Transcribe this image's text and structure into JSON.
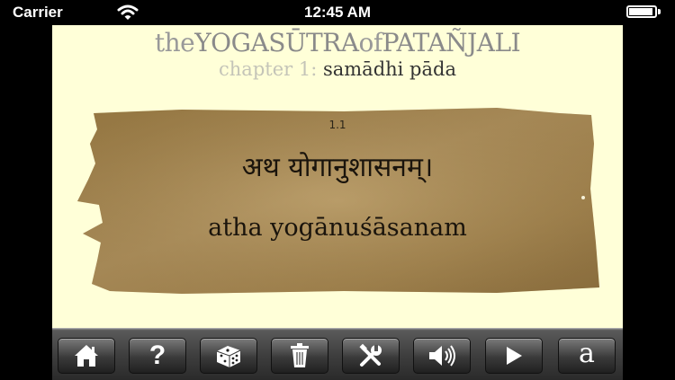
{
  "status_bar": {
    "carrier": "Carrier",
    "time": "12:45 AM"
  },
  "header": {
    "title_the": "the",
    "title_yoga": "YOGA",
    "title_sutra": "SŪTRA",
    "title_of": "of",
    "title_patanjali": "PATAÑJALI",
    "chapter_label": "chapter 1:",
    "chapter_name": "samādhi pāda"
  },
  "verse": {
    "number": "1.1",
    "devanagari": "अथ योगानुशासनम्।",
    "transliteration": "atha yogānuśāsanam"
  },
  "toolbar": {
    "buttons": [
      {
        "name": "home-icon"
      },
      {
        "name": "help-icon",
        "label": "?"
      },
      {
        "name": "dice-icon"
      },
      {
        "name": "trash-icon"
      },
      {
        "name": "tools-icon"
      },
      {
        "name": "speaker-icon"
      },
      {
        "name": "play-icon"
      },
      {
        "name": "font-icon",
        "label": "a"
      }
    ]
  },
  "colors": {
    "page_background": "#ffffd8",
    "parchment": "#a88a52",
    "toolbar": "#3f3f3f"
  }
}
